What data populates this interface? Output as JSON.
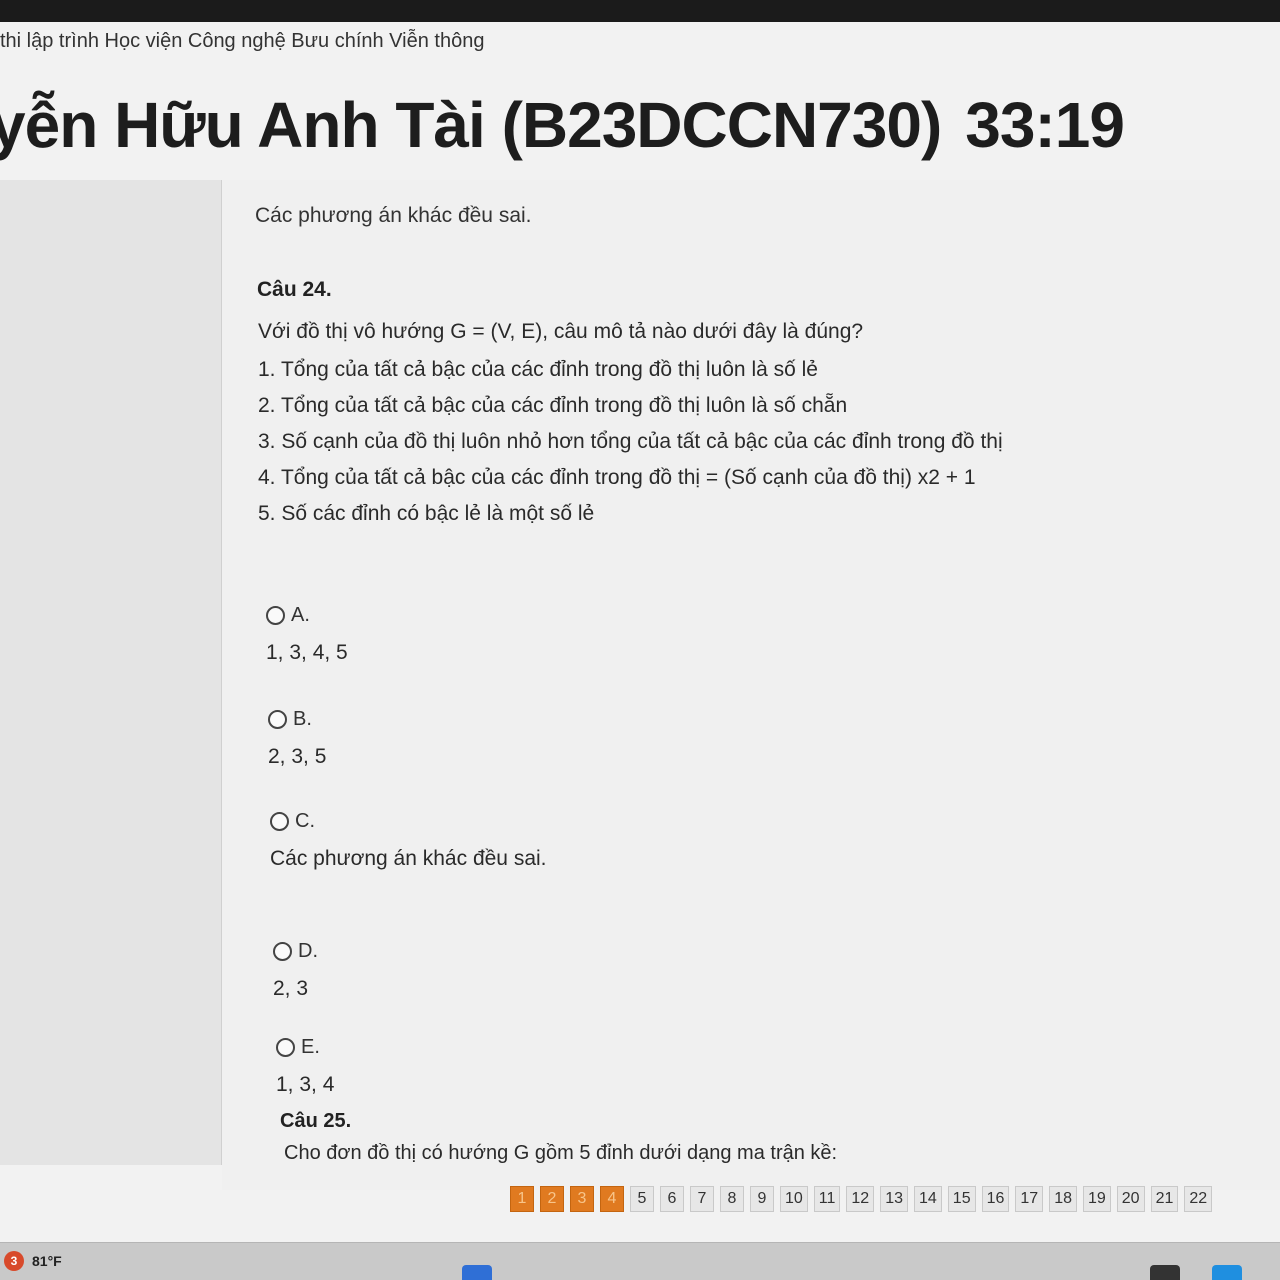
{
  "site_title": "thi lập trình Học viện Công nghệ Bưu chính Viễn thông",
  "student": {
    "name": "yễn Hữu Anh Tài (B23DCCN730)",
    "timer": "33:19"
  },
  "previous_answer_text": "Các phương án khác đều sai.",
  "question": {
    "number_label": "Câu 24.",
    "text": "Với đồ thị vô hướng G = (V, E), câu mô tả nào dưới đây là đúng?",
    "statements": [
      "1. Tổng của tất cả bậc của các đỉnh trong đồ thị luôn là số lẻ",
      "2. Tổng của tất cả bậc của các đỉnh trong đồ thị luôn là số chẵn",
      "3. Số cạnh của đồ thị luôn nhỏ hơn tổng của tất cả bậc của các đỉnh trong đồ thị",
      "4. Tổng của tất cả bậc của các đỉnh trong đồ thị = (Số cạnh của đồ thị) x2 + 1",
      "5. Số các đỉnh có bậc lẻ là một số lẻ"
    ],
    "options": [
      {
        "label": "A.",
        "text": "1, 3, 4, 5"
      },
      {
        "label": "B.",
        "text": "2, 3, 5"
      },
      {
        "label": "C.",
        "text": "Các phương án khác đều sai."
      },
      {
        "label": "D.",
        "text": "2, 3"
      },
      {
        "label": "E.",
        "text": "1, 3, 4"
      }
    ]
  },
  "next_question": {
    "number_label": "Câu 25.",
    "text": "Cho đơn đồ thị có hướng G gồm 5 đỉnh dưới dạng ma trận kề:"
  },
  "question_nav": [
    "1",
    "2",
    "3",
    "4",
    "5",
    "6",
    "7",
    "8",
    "9",
    "10",
    "11",
    "12",
    "13",
    "14",
    "15",
    "16",
    "17",
    "18",
    "19",
    "20",
    "21",
    "22"
  ],
  "answered_questions": [
    "1",
    "2",
    "3",
    "4"
  ],
  "taskbar": {
    "notification_count": "3",
    "temperature": "81°F"
  },
  "colors": {
    "answered": "#e07a20",
    "unanswered": "#e7e7e7"
  }
}
